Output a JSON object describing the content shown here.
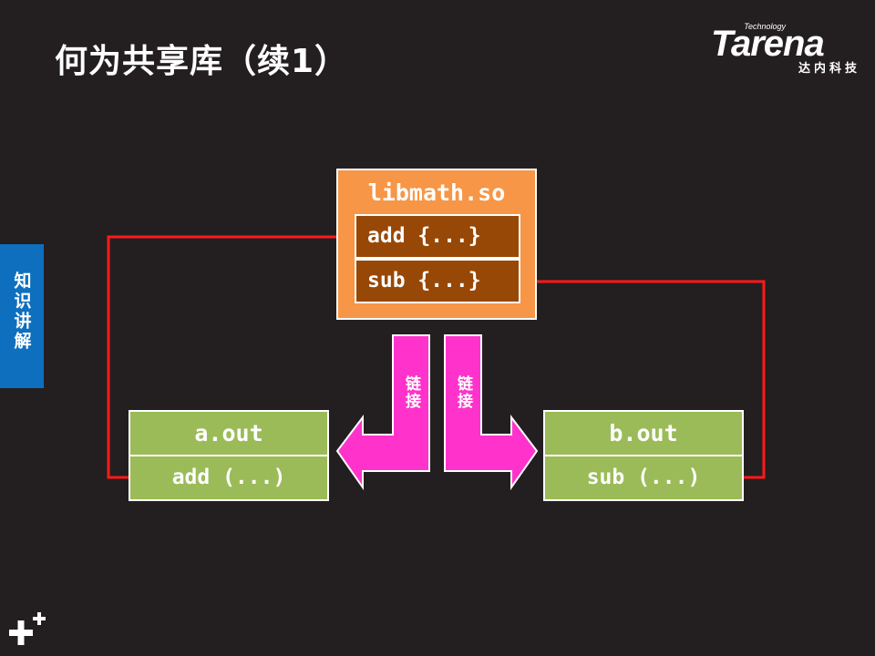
{
  "header": {
    "title": "何为共享库（续1）"
  },
  "logo": {
    "technology": "Technology",
    "brand": "Tarena",
    "subtitle": "达内科技"
  },
  "side_tab": {
    "label": "知识讲解"
  },
  "diagram": {
    "library": {
      "name": "libmath.so",
      "functions": [
        "add {...}",
        "sub {...}"
      ]
    },
    "programs": [
      {
        "name": "a.out",
        "call": "add (...)"
      },
      {
        "name": "b.out",
        "call": "sub (...)"
      }
    ],
    "link_labels": [
      "链接",
      "链接"
    ]
  },
  "colors": {
    "background": "#231f20",
    "library_box": "#f79646",
    "function_box": "#984806",
    "program_box": "#9bbb59",
    "link_arrow": "#ff33cc",
    "call_line": "#ff1a1a",
    "side_tab": "#0e6fbf"
  }
}
